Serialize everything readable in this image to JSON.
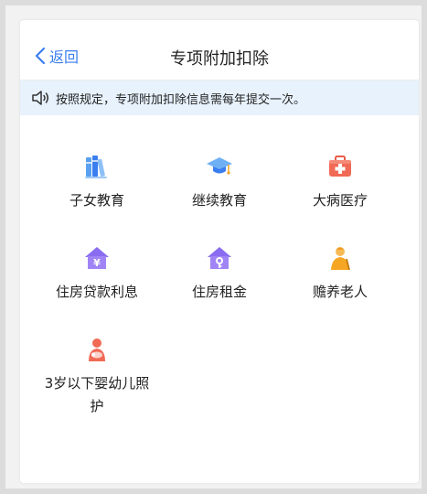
{
  "header": {
    "back_label": "返回",
    "title": "专项附加扣除"
  },
  "notice": {
    "icon": "speaker-icon",
    "text": "按照规定，专项附加扣除信息需每年提交一次。"
  },
  "items": [
    {
      "label": "子女教育",
      "icon": "books-icon"
    },
    {
      "label": "继续教育",
      "icon": "graduation-cap-icon"
    },
    {
      "label": "大病医疗",
      "icon": "first-aid-kit-icon"
    },
    {
      "label": "住房贷款利息",
      "icon": "house-yuan-icon"
    },
    {
      "label": "住房租金",
      "icon": "house-key-icon"
    },
    {
      "label": "赡养老人",
      "icon": "elderly-person-icon"
    },
    {
      "label": "3岁以下婴幼儿照护",
      "icon": "mother-baby-icon"
    }
  ],
  "colors": {
    "accent": "#3b7ef0",
    "notice_bg": "#e8f2fd"
  }
}
